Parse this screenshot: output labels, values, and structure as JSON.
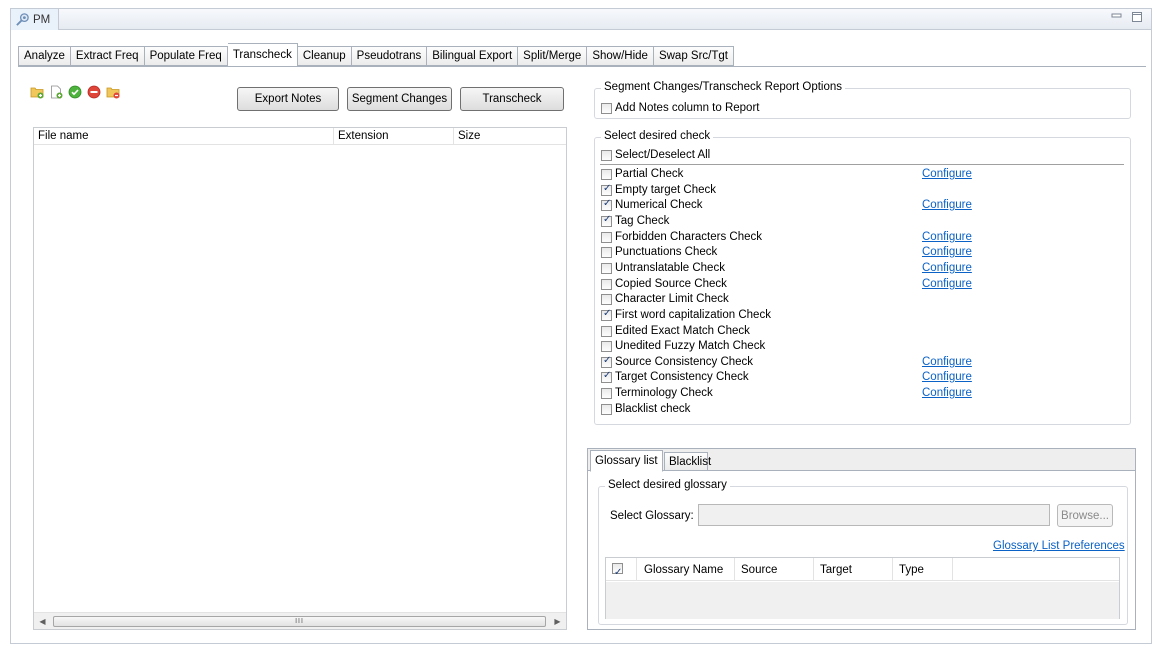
{
  "window": {
    "view_tab_label": "PM",
    "view_icon": "pm-view-icon"
  },
  "tabs": [
    "Analyze",
    "Extract Freq",
    "Populate Freq",
    "Transcheck",
    "Cleanup",
    "Pseudotrans",
    "Bilingual Export",
    "Split/Merge",
    "Show/Hide",
    "Swap Src/Tgt"
  ],
  "active_tab": "Transcheck",
  "toolbar": {
    "icons": [
      "add-folder-icon",
      "add-file-icon",
      "check-all-icon",
      "remove-icon",
      "clear-folder-icon"
    ],
    "export_notes": "Export Notes",
    "segment_changes": "Segment Changes",
    "transcheck": "Transcheck"
  },
  "file_table": {
    "columns": [
      "File name",
      "Extension",
      "Size"
    ],
    "scroll_grip": "III"
  },
  "report_options": {
    "title": "Segment Changes/Transcheck Report Options",
    "add_notes_label": "Add Notes column to Report",
    "add_notes_checked": false
  },
  "checks": {
    "title": "Select desired check",
    "select_all_label": "Select/Deselect All",
    "configure_label": "Configure",
    "items": [
      {
        "label": "Partial Check",
        "checked": false,
        "configure": true
      },
      {
        "label": "Empty target Check",
        "checked": true,
        "configure": false
      },
      {
        "label": "Numerical Check",
        "checked": true,
        "configure": true
      },
      {
        "label": "Tag Check",
        "checked": true,
        "configure": false
      },
      {
        "label": "Forbidden Characters Check",
        "checked": false,
        "configure": true
      },
      {
        "label": "Punctuations Check",
        "checked": false,
        "configure": true
      },
      {
        "label": "Untranslatable Check",
        "checked": false,
        "configure": true
      },
      {
        "label": "Copied Source Check",
        "checked": false,
        "configure": true
      },
      {
        "label": "Character Limit Check",
        "checked": false,
        "configure": false
      },
      {
        "label": "First word capitalization Check",
        "checked": true,
        "configure": false
      },
      {
        "label": "Edited Exact Match Check",
        "checked": false,
        "configure": false
      },
      {
        "label": "Unedited Fuzzy Match Check",
        "checked": false,
        "configure": false
      },
      {
        "label": "Source Consistency Check",
        "checked": true,
        "configure": true
      },
      {
        "label": "Target Consistency Check",
        "checked": true,
        "configure": true
      },
      {
        "label": "Terminology Check",
        "checked": false,
        "configure": true
      },
      {
        "label": "Blacklist check",
        "checked": false,
        "configure": false
      }
    ]
  },
  "lower_tabs": [
    "Glossary list",
    "Blacklist"
  ],
  "glossary": {
    "group_title": "Select desired glossary",
    "select_label": "Select Glossary:",
    "select_value": "",
    "browse_label": "Browse...",
    "preferences_link": "Glossary List Preferences",
    "columns": [
      "Glossary Name",
      "Source",
      "Target",
      "Type"
    ],
    "header_checked": true
  }
}
